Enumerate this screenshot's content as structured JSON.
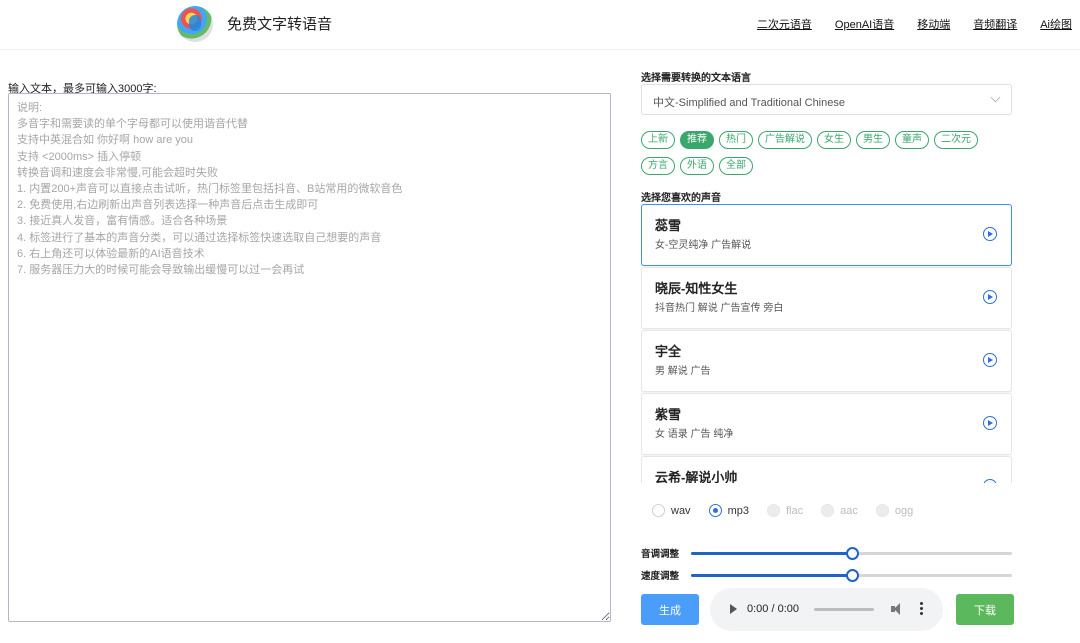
{
  "header": {
    "title": "免费文字转语音",
    "logo": "colorful-avatar-logo",
    "nav": [
      "二次元语音",
      "OpenAI语音",
      "移动端",
      "音频翻译",
      "Ai绘图"
    ]
  },
  "input": {
    "label": "输入文本，最多可输入3000字:",
    "placeholder": "说明:\n多音字和需要读的单个字母都可以使用谐音代替\n支持中英混合如 你好啊 how are you\n支持 <2000ms> 插入停顿\n转换音调和速度会非常慢,可能会超时失败\n1. 内置200+声音可以直接点击试听，热门标签里包括抖音、B站常用的微软音色\n2. 免费使用,右边刷新出声音列表选择一种声音后点击生成即可\n3. 接近真人发音，富有情感。适合各种场景\n4. 标签进行了基本的声音分类，可以通过选择标签快速选取自己想要的声音\n6. 右上角还可以体验最新的AI语音技术\n7. 服务器压力大的时候可能会导致输出缓慢可以过一会再试",
    "value": ""
  },
  "language": {
    "label": "选择需要转换的文本语言",
    "selected": "中文-Simplified and Traditional Chinese"
  },
  "tags": {
    "row1": [
      "上新",
      "推荐",
      "热门",
      "广告解说",
      "女生",
      "男生",
      "童声",
      "二次元"
    ],
    "row2": [
      "方言",
      "外语",
      "全部"
    ],
    "active": "推荐"
  },
  "voices": {
    "label": "选择您喜欢的声音",
    "items": [
      {
        "name": "蕊雪",
        "desc": "女-空灵纯净 广告解说"
      },
      {
        "name": "晓辰-知性女生",
        "desc": "抖音热门 解说 广告宣传 旁白"
      },
      {
        "name": "宇全",
        "desc": "男 解说 广告"
      },
      {
        "name": "紫雪",
        "desc": "女 语录 广告 纯净"
      },
      {
        "name": "云希-解说小帅",
        "desc": ""
      }
    ]
  },
  "formats": {
    "options": [
      "wav",
      "mp3",
      "flac",
      "aac",
      "ogg"
    ],
    "selected": "mp3",
    "disabled": [
      "flac",
      "aac",
      "ogg"
    ]
  },
  "sliders": {
    "pitch": {
      "label": "音调调整",
      "value": 0.5
    },
    "speed": {
      "label": "速度调整",
      "value": 0.5
    }
  },
  "actions": {
    "generate": "生成",
    "download": "下载"
  },
  "audio": {
    "time": "0:00 / 0:00"
  },
  "colors": {
    "accent_green": "#3aa76d",
    "accent_blue": "#4a9df8",
    "download_green": "#5cb85c",
    "selected_border": "#3f8ef7"
  }
}
